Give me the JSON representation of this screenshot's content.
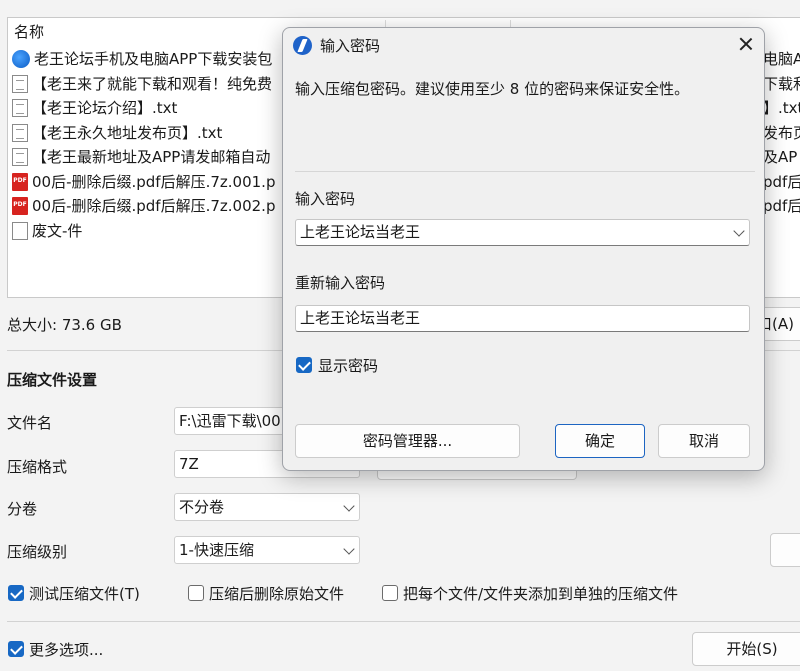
{
  "file_list": {
    "column_name": "名称",
    "rows": [
      {
        "icon": "app-icon",
        "name": "老王论坛手机及电脑APP下载安装包",
        "right": "电脑A"
      },
      {
        "icon": "text-file-icon",
        "name": "【老王来了就能下载和观看！纯免费",
        "right": "下载和"
      },
      {
        "icon": "text-file-icon",
        "name": "【老王论坛介绍】.txt",
        "right": "】.txt"
      },
      {
        "icon": "text-file-icon",
        "name": "【老王永久地址发布页】.txt",
        "right": "发布页"
      },
      {
        "icon": "text-file-icon",
        "name": "【老王最新地址及APP请发邮箱自动",
        "right": "及AP"
      },
      {
        "icon": "pdf-file-icon",
        "name": "00后-删除后缀.pdf后解压.7z.001.p",
        "right": "pdf后"
      },
      {
        "icon": "pdf-file-icon",
        "name": "00后-删除后缀.pdf后解压.7z.002.p",
        "right": "pdf后"
      },
      {
        "icon": "blank-file-icon",
        "name": "废文-件",
        "right": ""
      }
    ]
  },
  "total_size_label": "总大小: 73.6 GB",
  "right_button_fragment": "口(A)",
  "settings": {
    "heading": "压缩文件设置",
    "filename_label": "文件名",
    "filename_value": "F:\\迅雷下载\\00",
    "format_label": "压缩格式",
    "format_value": "7Z",
    "volume_label": "分卷",
    "volume_value": "不分卷",
    "level_label": "压缩级别",
    "level_value": "1-快速压缩",
    "test_label": "测试压缩文件(T)",
    "test_checked": true,
    "delete_label": "压缩后删除原始文件",
    "delete_checked": false,
    "separate_label": "把每个文件/文件夹添加到单独的压缩文件",
    "separate_checked": false,
    "more_label": "更多选项...",
    "more_checked": true,
    "start_label": "开始(S)"
  },
  "dialog": {
    "title": "输入密码",
    "description": "输入压缩包密码。建议使用至少 8 位的密码来保证安全性。",
    "password_label": "输入密码",
    "password_value": "上老王论坛当老王",
    "confirm_label": "重新输入密码",
    "confirm_value": "上老王论坛当老王",
    "show_password_label": "显示密码",
    "show_password_checked": true,
    "manager_button": "密码管理器...",
    "ok_button": "确定",
    "cancel_button": "取消"
  },
  "colors": {
    "accent": "#1768c4",
    "pdf_red": "#d7231f"
  }
}
